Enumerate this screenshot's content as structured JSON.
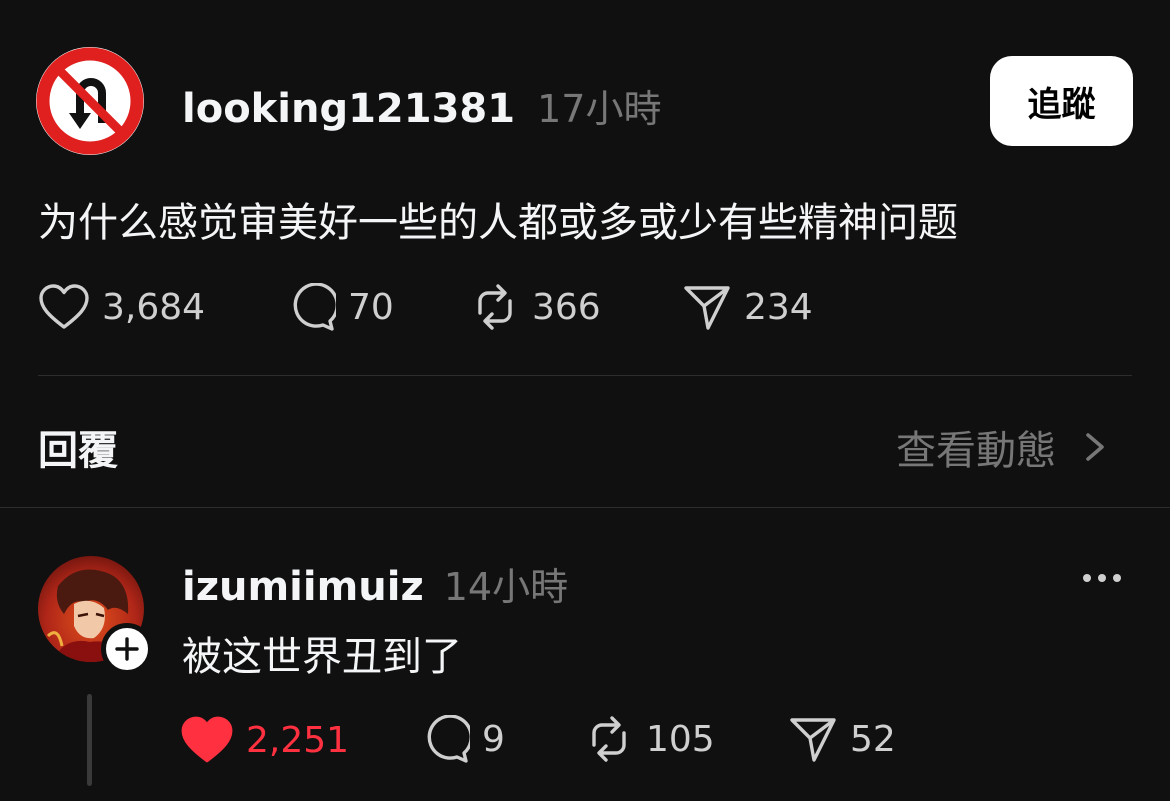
{
  "post": {
    "username": "looking121381",
    "time": "17小時",
    "follow_label": "追蹤",
    "text": "为什么感觉审美好一些的人都或多或少有些精神问题",
    "likes": "3,684",
    "comments": "70",
    "reposts": "366",
    "shares": "234"
  },
  "replies_section": {
    "title": "回覆",
    "view_activity": "查看動態"
  },
  "reply": {
    "username": "izumiimuiz",
    "time": "14小時",
    "text": "被这世界丑到了",
    "likes": "2,251",
    "liked": true,
    "comments": "9",
    "reposts": "105",
    "shares": "52"
  },
  "colors": {
    "background": "#101010",
    "text": "#f3f5f7",
    "muted": "#777777",
    "like_active": "#ff3040",
    "no_uturn_red": "#e0201f"
  },
  "icons": [
    "no-u-turn-icon",
    "heart-icon",
    "comment-icon",
    "repost-icon",
    "share-icon",
    "chevron-right-icon",
    "more-icon",
    "plus-icon"
  ]
}
